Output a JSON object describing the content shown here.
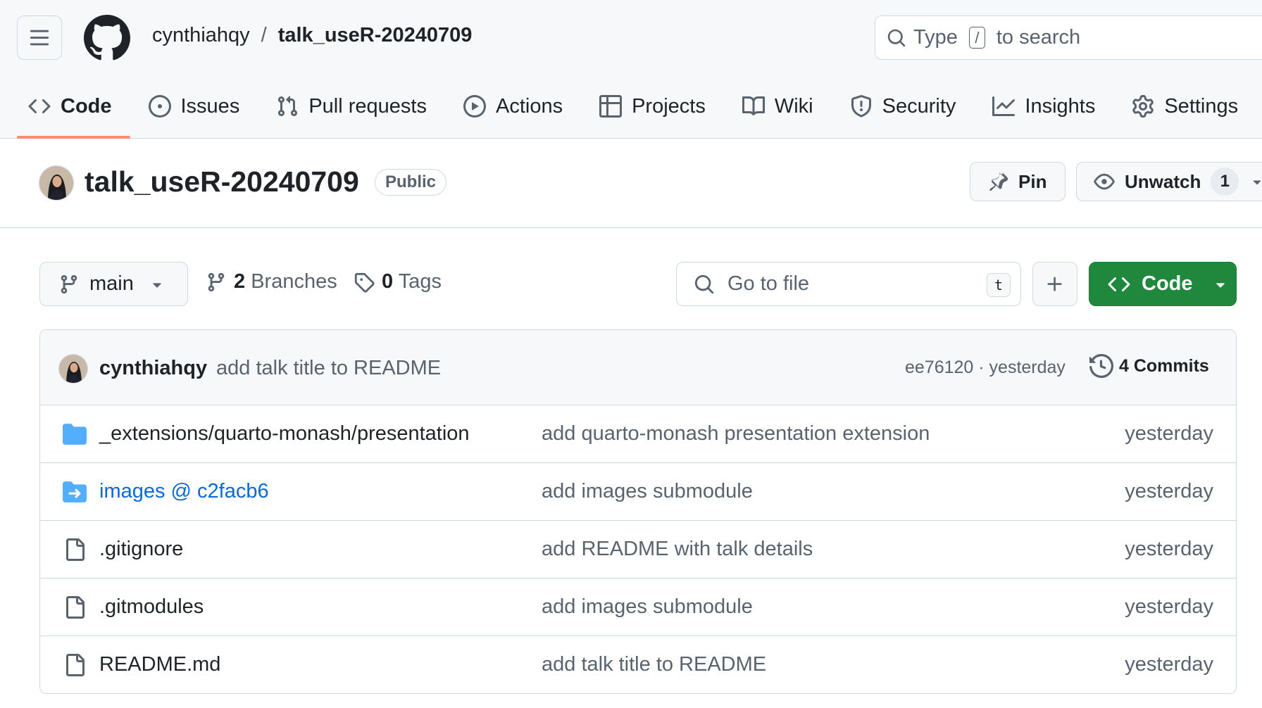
{
  "header": {
    "owner": "cynthiahqy",
    "separator": "/",
    "repo": "talk_useR-20240709",
    "search": {
      "prefix": "Type",
      "key": "/",
      "suffix": "to search"
    }
  },
  "tabs": [
    {
      "label": "Code",
      "icon": "code-icon",
      "active": true
    },
    {
      "label": "Issues",
      "icon": "issue-opened-icon"
    },
    {
      "label": "Pull requests",
      "icon": "git-pull-request-icon"
    },
    {
      "label": "Actions",
      "icon": "play-icon"
    },
    {
      "label": "Projects",
      "icon": "table-icon"
    },
    {
      "label": "Wiki",
      "icon": "book-icon"
    },
    {
      "label": "Security",
      "icon": "shield-icon"
    },
    {
      "label": "Insights",
      "icon": "graph-icon"
    },
    {
      "label": "Settings",
      "icon": "gear-icon"
    }
  ],
  "repo_head": {
    "title": "talk_useR-20240709",
    "visibility": "Public",
    "pin_label": "Pin",
    "watch_label": "Unwatch",
    "watch_count": "1"
  },
  "file_nav": {
    "branch": "main",
    "branches_count": "2",
    "branches_label": "Branches",
    "tags_count": "0",
    "tags_label": "Tags",
    "goto_placeholder": "Go to file",
    "goto_key": "t",
    "code_label": "Code"
  },
  "latest_commit": {
    "author": "cynthiahqy",
    "message": "add talk title to README",
    "meta": "ee76120 · yesterday",
    "commits_label": "4 Commits"
  },
  "files": [
    {
      "name": "_extensions/quarto-monash/presentation",
      "type": "folder",
      "commit": "add quarto-monash presentation extension",
      "time": "yesterday"
    },
    {
      "name": "images @ c2facb6",
      "type": "submodule",
      "commit": "add images submodule",
      "time": "yesterday"
    },
    {
      "name": ".gitignore",
      "type": "file",
      "commit": "add README with talk details",
      "time": "yesterday"
    },
    {
      "name": ".gitmodules",
      "type": "file",
      "commit": "add images submodule",
      "time": "yesterday"
    },
    {
      "name": "README.md",
      "type": "file",
      "commit": "add talk title to README",
      "time": "yesterday"
    }
  ],
  "colors": {
    "accent_underline": "#fd8c73",
    "code_button": "#1f883d",
    "link": "#0969da",
    "folder": "#54aeff"
  }
}
